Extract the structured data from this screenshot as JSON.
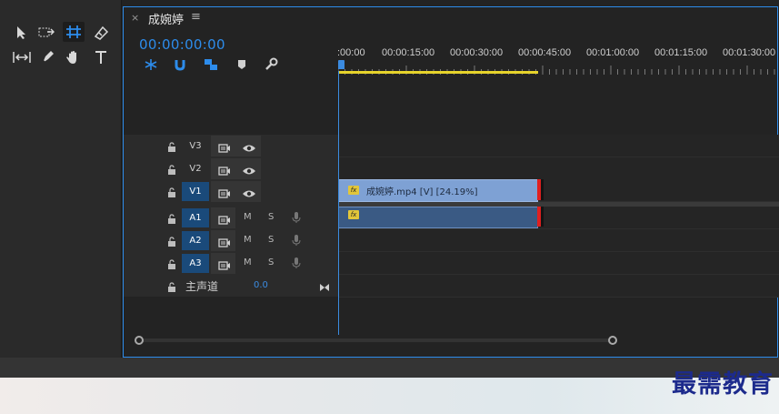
{
  "tab": {
    "close_glyph": "×",
    "title": "成婉婷",
    "menu_glyph": "≡"
  },
  "timecode": "00:00:00:00",
  "ruler": {
    "labels": [
      ":00:00",
      "00:00:15:00",
      "00:00:30:00",
      "00:00:45:00",
      "00:01:00:00",
      "00:01:15:00",
      "00:01:30:00"
    ]
  },
  "tools": [
    "selection-tool",
    "track-select-tool",
    "ripple-edit-tool",
    "razor-tool",
    "slip-tool",
    "pen-tool",
    "hand-tool",
    "type-tool"
  ],
  "tracks": {
    "video": [
      {
        "name": "V3",
        "targeted": false
      },
      {
        "name": "V2",
        "targeted": false
      },
      {
        "name": "V1",
        "targeted": true
      }
    ],
    "audio": [
      {
        "name": "A1",
        "m": "M",
        "s": "S"
      },
      {
        "name": "A2",
        "m": "M",
        "s": "S"
      },
      {
        "name": "A3",
        "m": "M",
        "s": "S"
      }
    ],
    "master": {
      "label": "主声道",
      "value": "0.0"
    }
  },
  "clips": {
    "video": {
      "fx": "fx",
      "label": "成婉婷.mp4 [V] [24.19%]"
    },
    "audio": {
      "fx": "fx"
    }
  },
  "watermark": "最需教育",
  "colors": {
    "accent": "#2d8ceb",
    "work_area": "#e6d32b",
    "video_clip": "#7ea1d4",
    "audio_clip": "#3a5a84",
    "clip_end": "#e02020"
  }
}
